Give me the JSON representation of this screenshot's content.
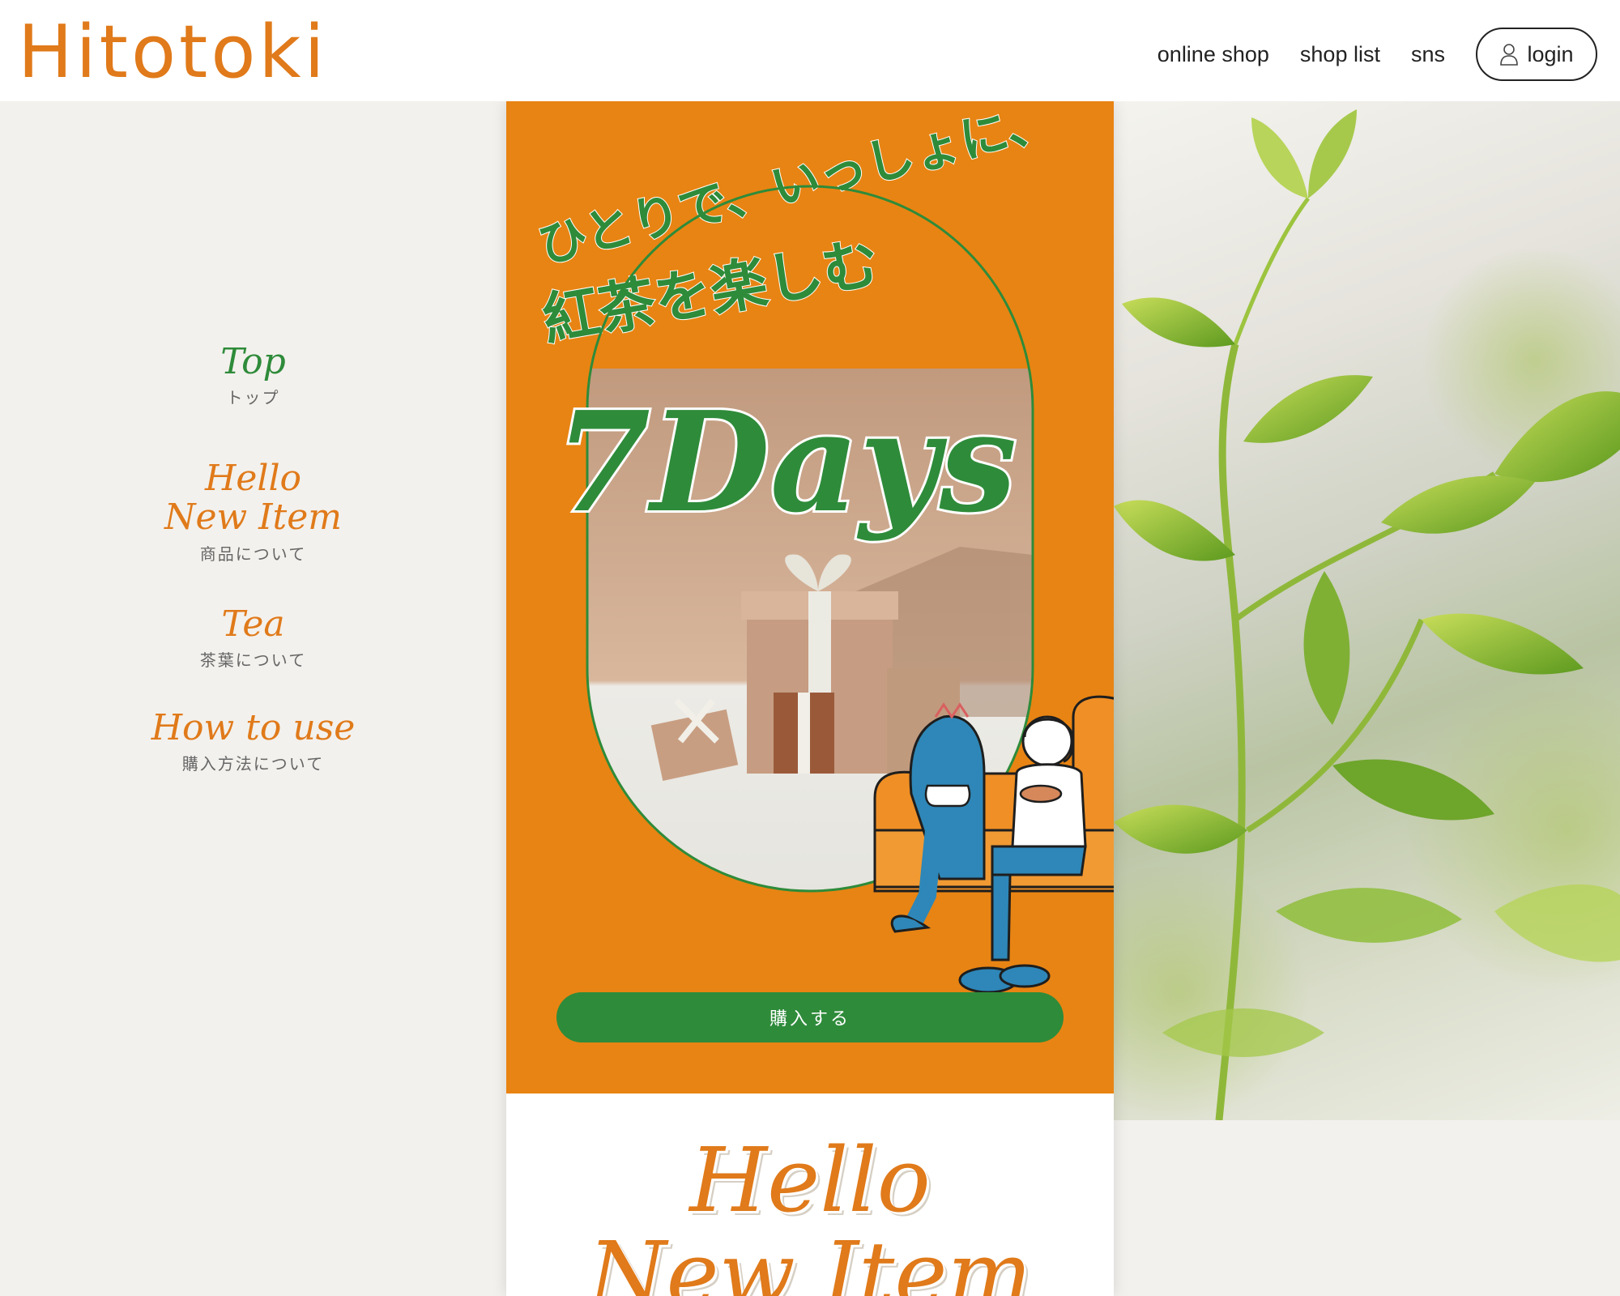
{
  "header": {
    "logo": "Hitotoki",
    "nav": [
      {
        "label": "online shop"
      },
      {
        "label": "shop list"
      },
      {
        "label": "sns"
      }
    ],
    "login_label": "login"
  },
  "side_menu": [
    {
      "en": "Top",
      "jp": "トップ",
      "color": "green"
    },
    {
      "en": "Hello",
      "en2": "New Item",
      "jp": "商品について",
      "color": "orange"
    },
    {
      "en": "Tea",
      "jp": "茶葉について",
      "color": "orange"
    },
    {
      "en": "How to use",
      "jp": "購入方法について",
      "color": "orange"
    }
  ],
  "hero": {
    "tagline_1": "ひとりで、いっしょに、",
    "tagline_2": "紅茶を楽しむ",
    "title": "7Days",
    "buy_label": "購入する",
    "bg_color": "#e88413",
    "accent_color": "#2e8b3a"
  },
  "next_section": {
    "title_1": "Hello",
    "title_2": "New Item"
  }
}
